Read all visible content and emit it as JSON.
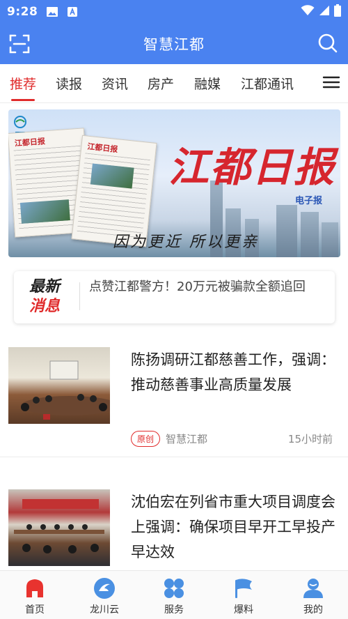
{
  "status_bar": {
    "time": "9:28",
    "icons": [
      "image-icon",
      "a-icon",
      "wifi-icon",
      "signal-icon",
      "battery-icon"
    ]
  },
  "header": {
    "title": "智慧江都",
    "left_icon": "scan-icon",
    "right_icon": "search-icon",
    "bg_color": "#4a82f0"
  },
  "tabs": {
    "items": [
      {
        "label": "推荐",
        "active": true
      },
      {
        "label": "读报",
        "active": false
      },
      {
        "label": "资讯",
        "active": false
      },
      {
        "label": "房产",
        "active": false
      },
      {
        "label": "融媒",
        "active": false
      },
      {
        "label": "江都通讯",
        "active": false
      }
    ],
    "active_color": "#e02b2b",
    "menu_icon": "menu-icon"
  },
  "banner": {
    "brand": "江都日报",
    "subtitle": "电子报",
    "slogan": "因为更近 所以更亲",
    "paper_masthead": "江都日报"
  },
  "ticker": {
    "tag_line1": "最新",
    "tag_line2": "消息",
    "text": "点赞江都警方！20万元被骗款全额追回"
  },
  "articles": [
    {
      "headline": "陈扬调研江都慈善工作，强调：推动慈善事业高质量发展",
      "badge": "原创",
      "source": "智慧江都",
      "time": "15小时前"
    },
    {
      "headline": "沈伯宏在列省市重大项目调度会上强调：确保项目早开工早投产早达效"
    }
  ],
  "bottom_nav": [
    {
      "label": "首页",
      "icon": "home-icon",
      "active": true
    },
    {
      "label": "龙川云",
      "icon": "cloud-icon",
      "active": false
    },
    {
      "label": "服务",
      "icon": "services-icon",
      "active": false
    },
    {
      "label": "爆料",
      "icon": "flag-icon",
      "active": false
    },
    {
      "label": "我的",
      "icon": "profile-icon",
      "active": false
    }
  ]
}
